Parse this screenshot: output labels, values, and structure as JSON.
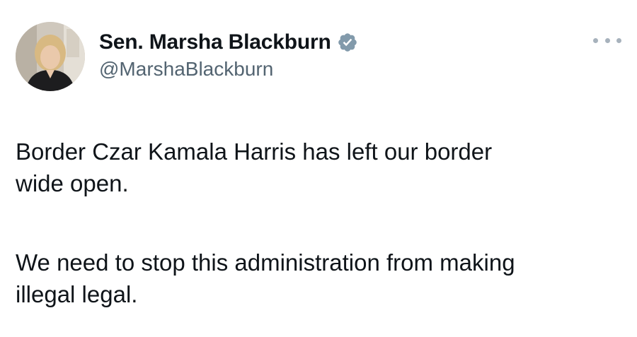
{
  "author": {
    "display_name": "Sen. Marsha Blackburn",
    "handle": "@MarshaBlackburn",
    "verified_icon": "verified-badge-icon",
    "avatar": "profile-photo"
  },
  "menu": {
    "icon": "more-horizontal-icon"
  },
  "tweet": {
    "paragraphs": [
      "Border Czar Kamala Harris has left our border\nwide open.",
      "We need to stop this administration from making\nillegal legal."
    ]
  },
  "colors": {
    "text_primary": "#0f1419",
    "text_secondary": "#536471",
    "verified_badge": "#829aab",
    "more_dots": "#a7b2bc"
  }
}
